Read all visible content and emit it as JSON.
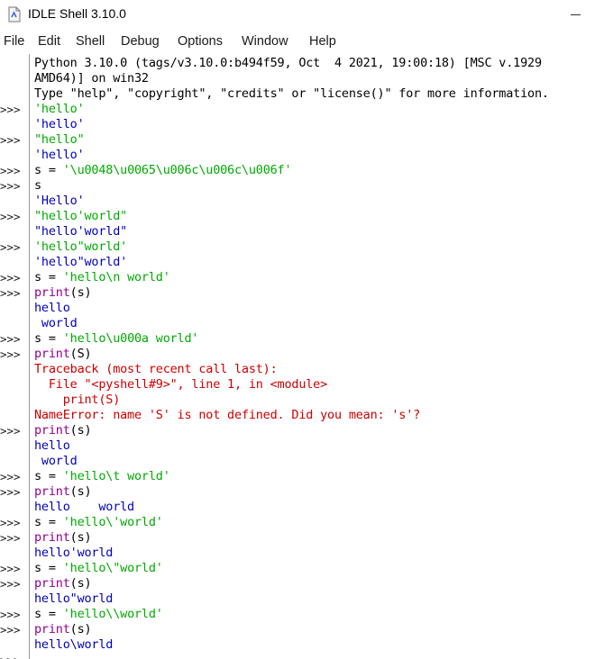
{
  "window": {
    "title": "IDLE Shell 3.10.0",
    "minimize_glyph": ""
  },
  "menu": [
    "File",
    "Edit",
    "Shell",
    "Debug",
    "Options",
    "Window",
    "Help"
  ],
  "prompt_symbol": ">>>",
  "colors": {
    "string": "#00aa00",
    "stdout": "#0000c0",
    "error": "#cc0000",
    "normal": "#000000"
  },
  "shell_lines": [
    {
      "kind": "out",
      "prompt": "",
      "text": "Python 3.10.0 (tags/v3.10.0:b494f59, Oct  4 2021, 19:00:18) [MSC v.1929"
    },
    {
      "kind": "out",
      "prompt": "",
      "text": "AMD64)] on win32"
    },
    {
      "kind": "out",
      "prompt": "",
      "text": "Type \"help\", \"copyright\", \"credits\" or \"license()\" for more information."
    },
    {
      "kind": "str",
      "prompt": ">>>",
      "text": "'hello'"
    },
    {
      "kind": "stdout",
      "prompt": "",
      "text": "'hello'"
    },
    {
      "kind": "str",
      "prompt": ">>>",
      "text": "\"hello\""
    },
    {
      "kind": "stdout",
      "prompt": "",
      "text": "'hello'"
    },
    {
      "kind": "mixed",
      "prompt": ">>>",
      "pre": "s = ",
      "str": "'\\u0048\\u0065\\u006c\\u006c\\u006f'"
    },
    {
      "kind": "out",
      "prompt": ">>>",
      "text": "s"
    },
    {
      "kind": "stdout",
      "prompt": "",
      "text": "'Hello'"
    },
    {
      "kind": "str",
      "prompt": ">>>",
      "text": "\"hello'world\""
    },
    {
      "kind": "stdout",
      "prompt": "",
      "text": "\"hello'world\""
    },
    {
      "kind": "str",
      "prompt": ">>>",
      "text": "'hello\"world'"
    },
    {
      "kind": "stdout",
      "prompt": "",
      "text": "'hello\"world'"
    },
    {
      "kind": "mixed",
      "prompt": ">>>",
      "pre": "s = ",
      "str": "'hello\\n world'"
    },
    {
      "kind": "call",
      "prompt": ">>>",
      "fn": "print",
      "args": "(s)"
    },
    {
      "kind": "stdout",
      "prompt": "",
      "text": "hello"
    },
    {
      "kind": "stdout",
      "prompt": "",
      "text": " world"
    },
    {
      "kind": "mixed",
      "prompt": ">>>",
      "pre": "s = ",
      "str": "'hello\\u000a world'"
    },
    {
      "kind": "call",
      "prompt": ">>>",
      "fn": "print",
      "args": "(S)"
    },
    {
      "kind": "err",
      "prompt": "",
      "text": "Traceback (most recent call last):"
    },
    {
      "kind": "err",
      "prompt": "",
      "text": "  File \"<pyshell#9>\", line 1, in <module>"
    },
    {
      "kind": "err",
      "prompt": "",
      "text": "    print(S)"
    },
    {
      "kind": "err",
      "prompt": "",
      "text": "NameError: name 'S' is not defined. Did you mean: 's'?"
    },
    {
      "kind": "call",
      "prompt": ">>>",
      "fn": "print",
      "args": "(s)"
    },
    {
      "kind": "stdout",
      "prompt": "",
      "text": "hello"
    },
    {
      "kind": "stdout",
      "prompt": "",
      "text": " world"
    },
    {
      "kind": "mixed",
      "prompt": ">>>",
      "pre": "s = ",
      "str": "'hello\\t world'"
    },
    {
      "kind": "call",
      "prompt": ">>>",
      "fn": "print",
      "args": "(s)"
    },
    {
      "kind": "stdout",
      "prompt": "",
      "text": "hello    world"
    },
    {
      "kind": "mixed",
      "prompt": ">>>",
      "pre": "s = ",
      "str": "'hello\\'world'"
    },
    {
      "kind": "call",
      "prompt": ">>>",
      "fn": "print",
      "args": "(s)"
    },
    {
      "kind": "stdout",
      "prompt": "",
      "text": "hello'world"
    },
    {
      "kind": "mixed",
      "prompt": ">>>",
      "pre": "s = ",
      "str": "'hello\\\"world'"
    },
    {
      "kind": "call",
      "prompt": ">>>",
      "fn": "print",
      "args": "(s)"
    },
    {
      "kind": "stdout",
      "prompt": "",
      "text": "hello\"world"
    },
    {
      "kind": "mixed",
      "prompt": ">>>",
      "pre": "s = ",
      "str": "'hello\\\\world'"
    },
    {
      "kind": "call",
      "prompt": ">>>",
      "fn": "print",
      "args": "(s)"
    },
    {
      "kind": "stdout",
      "prompt": "",
      "text": "hello\\world"
    },
    {
      "kind": "out",
      "prompt": ">>>",
      "text": ""
    }
  ]
}
